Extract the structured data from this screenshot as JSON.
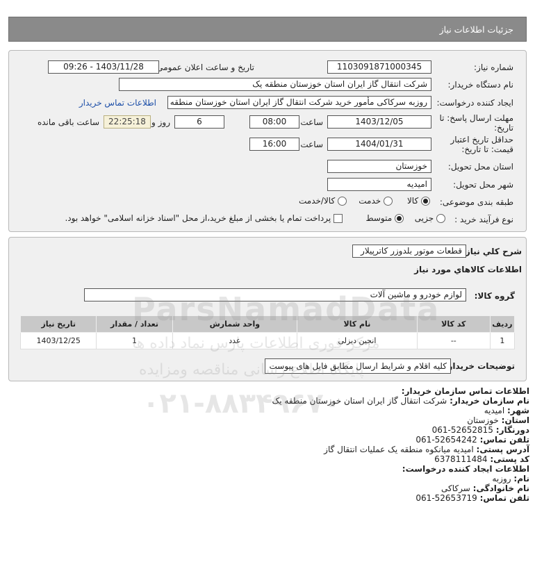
{
  "header": {
    "title": "جزئیات اطلاعات نیاز"
  },
  "form": {
    "need_number_label": "شماره نیاز:",
    "need_number": "1103091871000345",
    "announce_label": "تاریخ و ساعت اعلان عمومی:",
    "announce_value": "1403/11/28 - 09:26",
    "buyer_org_label": "نام دستگاه خریدار:",
    "buyer_org": "شرکت انتقال گاز ایران  استان خوزستان منطقه یک",
    "creator_label": "ایجاد کننده درخواست:",
    "creator": "روزبه سرکاکی مأمور خرید شرکت انتقال گاز ایران  استان خوزستان منطقه یک",
    "contact_link": "اطلاعات تماس خریدار",
    "deadline_label_1": "مهلت ارسال پاسخ: تا",
    "deadline_label_2": "تاریخ:",
    "deadline_date": "1403/12/05",
    "time_label": "ساعت",
    "deadline_time": "08:00",
    "days_value": "6",
    "days_label": "روز و",
    "remaining_time": "22:25:18",
    "remaining_label": "ساعت باقی مانده",
    "validity_label_1": "حداقل تاریخ اعتبار",
    "validity_label_2": "قیمت: تا تاریخ:",
    "validity_date": "1404/01/31",
    "validity_time": "16:00",
    "province_label": "استان محل تحویل:",
    "province": "خوزستان",
    "city_label": "شهر محل تحویل:",
    "city": "امیدیه",
    "category_label": "طبقه بندی موضوعی:",
    "category_options": [
      "کالا",
      "خدمت",
      "کالا/خدمت"
    ],
    "process_label": "نوع فرآیند خرید :",
    "process_options": [
      "جزیی",
      "متوسط"
    ],
    "payment_note": "پرداخت تمام یا بخشی از مبلغ خرید،از محل \"اسناد خزانه اسلامی\" خواهد بود."
  },
  "summary": {
    "label": "شرح کلي نياز:",
    "value": "قطعات موتور بلدوزر کاترپیلار",
    "goods_title": "اطلاعات کالاهاي مورد نياز",
    "group_label": "گروه کالا:",
    "group_value": "لوازم خودرو و ماشین آلات",
    "table": {
      "headers": [
        "ردیف",
        "کد کالا",
        "نام کالا",
        "واحد شمارش",
        "تعداد / مقدار",
        "تاریخ نیاز"
      ],
      "rows": [
        [
          "1",
          "--",
          "انجین دیزلی",
          "عدد",
          "1",
          "1403/12/25"
        ]
      ]
    },
    "buyer_notes_label": "توضیحات خریدار:",
    "buyer_notes": "کلیه اقلام و شرایط ارسال مطابق فایل های پیوست"
  },
  "contact": {
    "title": "اطلاعات تماس سازمان خریدار:",
    "org_label": "نام سازمان خریدار:",
    "org": "شرکت انتقال گاز ایران استان خوزستان منطقه یک",
    "city_label": "شهر:",
    "city": "امیدیه",
    "province_label": "استان:",
    "province": "خوزستان",
    "fax_label": "دورنگار:",
    "fax": "52652815-061",
    "phone_label": "تلفن تماس:",
    "phone": "52654242-061",
    "address_label": "آدرس پستی:",
    "address": "امیدیه میانکوه منطقه یک عملیات انتقال گاز",
    "postal_label": "کد پستی:",
    "postal": "6378111484",
    "creator_title": "اطلاعات ایجاد کننده درخواست:",
    "first_name_label": "نام:",
    "first_name": "روزبه",
    "last_name_label": "نام خانوادگی:",
    "last_name": "سرکاکی",
    "creator_phone_label": "تلفن تماس:",
    "creator_phone": "52653719-061"
  },
  "watermark": {
    "brand": "ParsNamadData",
    "line1": "مرکز فوری اطلاعات پارس نماد داده ها",
    "line2": "پایگاه اطلاع رسانی مناقصه ومزایده",
    "phone": "۰۲۱-۸۸۳۴۹۶۷۰"
  }
}
